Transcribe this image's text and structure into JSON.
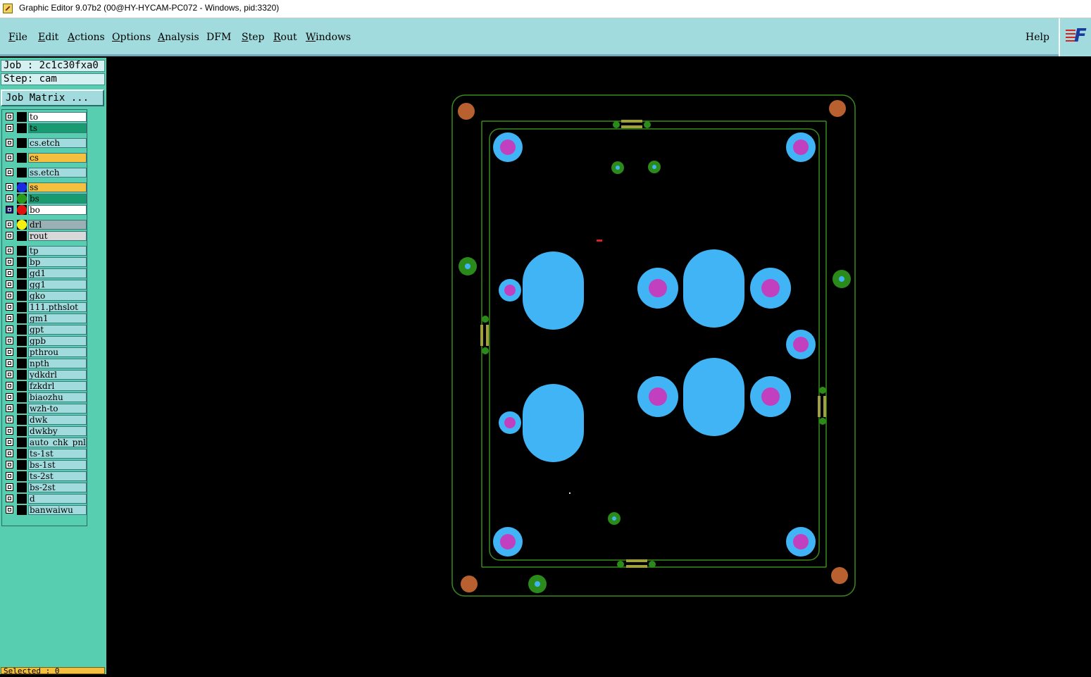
{
  "window": {
    "title": "Graphic Editor 9.07b2 (00@HY-HYCAM-PC072 - Windows, pid:3320)"
  },
  "menu": {
    "items": [
      {
        "u": "F",
        "rest": "ile"
      },
      {
        "u": "E",
        "rest": "dit"
      },
      {
        "u": "A",
        "rest": "ctions"
      },
      {
        "u": "O",
        "rest": "ptions"
      },
      {
        "u": "A",
        "rest": "nalysis"
      },
      {
        "u": "",
        "rest": "DFM"
      },
      {
        "u": "S",
        "rest": "tep"
      },
      {
        "u": "R",
        "rest": "out"
      },
      {
        "u": "W",
        "rest": "indows"
      }
    ],
    "help": "Help"
  },
  "logo": {
    "letter": "F"
  },
  "panel": {
    "job": "Job : 2c1c30fxa0",
    "step": "Step: cam",
    "job_matrix": "Job Matrix ...",
    "selected": "Selected : 0"
  },
  "layers": [
    {
      "name": "to",
      "bg": "#ffffff",
      "dot": ""
    },
    {
      "name": "ts",
      "bg": "#1a9a70",
      "dot": ""
    },
    {
      "name": "cs.etch",
      "bg": "",
      "dot": ""
    },
    {
      "name": "cs",
      "bg": "#f5c040",
      "dot": ""
    },
    {
      "name": "ss.etch",
      "bg": "",
      "dot": ""
    },
    {
      "name": "ss",
      "bg": "#f5c040",
      "dot": "#1a2ae0"
    },
    {
      "name": "bs",
      "bg": "#1a9a70",
      "dot": "#2a9a1a"
    },
    {
      "name": "bo",
      "bg": "#ffffff",
      "dot": "#e01010"
    },
    {
      "name": "drl",
      "bg": "#9ab0b4",
      "dot": "#f5f010"
    },
    {
      "name": "rout",
      "bg": "#d8d8d8",
      "dot": ""
    },
    {
      "name": "tp",
      "bg": "",
      "dot": ""
    },
    {
      "name": "bp",
      "bg": "",
      "dot": ""
    },
    {
      "name": "gd1",
      "bg": "",
      "dot": ""
    },
    {
      "name": "gg1",
      "bg": "",
      "dot": ""
    },
    {
      "name": "gko",
      "bg": "",
      "dot": ""
    },
    {
      "name": "111.pthslot",
      "bg": "",
      "dot": ""
    },
    {
      "name": "gm1",
      "bg": "",
      "dot": ""
    },
    {
      "name": "gpt",
      "bg": "",
      "dot": ""
    },
    {
      "name": "gpb",
      "bg": "",
      "dot": ""
    },
    {
      "name": "pthrou",
      "bg": "",
      "dot": ""
    },
    {
      "name": "npth",
      "bg": "",
      "dot": ""
    },
    {
      "name": "ydkdrl",
      "bg": "",
      "dot": ""
    },
    {
      "name": "fzkdrl",
      "bg": "",
      "dot": ""
    },
    {
      "name": "biaozhu",
      "bg": "",
      "dot": ""
    },
    {
      "name": "wzh-to",
      "bg": "",
      "dot": ""
    },
    {
      "name": "dwk",
      "bg": "",
      "dot": ""
    },
    {
      "name": "dwkby",
      "bg": "",
      "dot": ""
    },
    {
      "name": "auto_chk_pnl",
      "bg": "",
      "dot": ""
    },
    {
      "name": "ts-1st",
      "bg": "",
      "dot": ""
    },
    {
      "name": "bs-1st",
      "bg": "",
      "dot": ""
    },
    {
      "name": "ts-2st",
      "bg": "",
      "dot": ""
    },
    {
      "name": "bs-2st",
      "bg": "",
      "dot": ""
    },
    {
      "name": "d",
      "bg": "",
      "dot": ""
    },
    {
      "name": "banwaiwu",
      "bg": "",
      "dot": ""
    }
  ],
  "colors": {
    "menubar": "#a2dbdd",
    "panel": "#58ceb0",
    "outline": "#3a8a1a",
    "pad": "#40b4f5",
    "pad_center": "#c040c0",
    "fiducial": "#b86030",
    "via": "#2a8a1a"
  }
}
